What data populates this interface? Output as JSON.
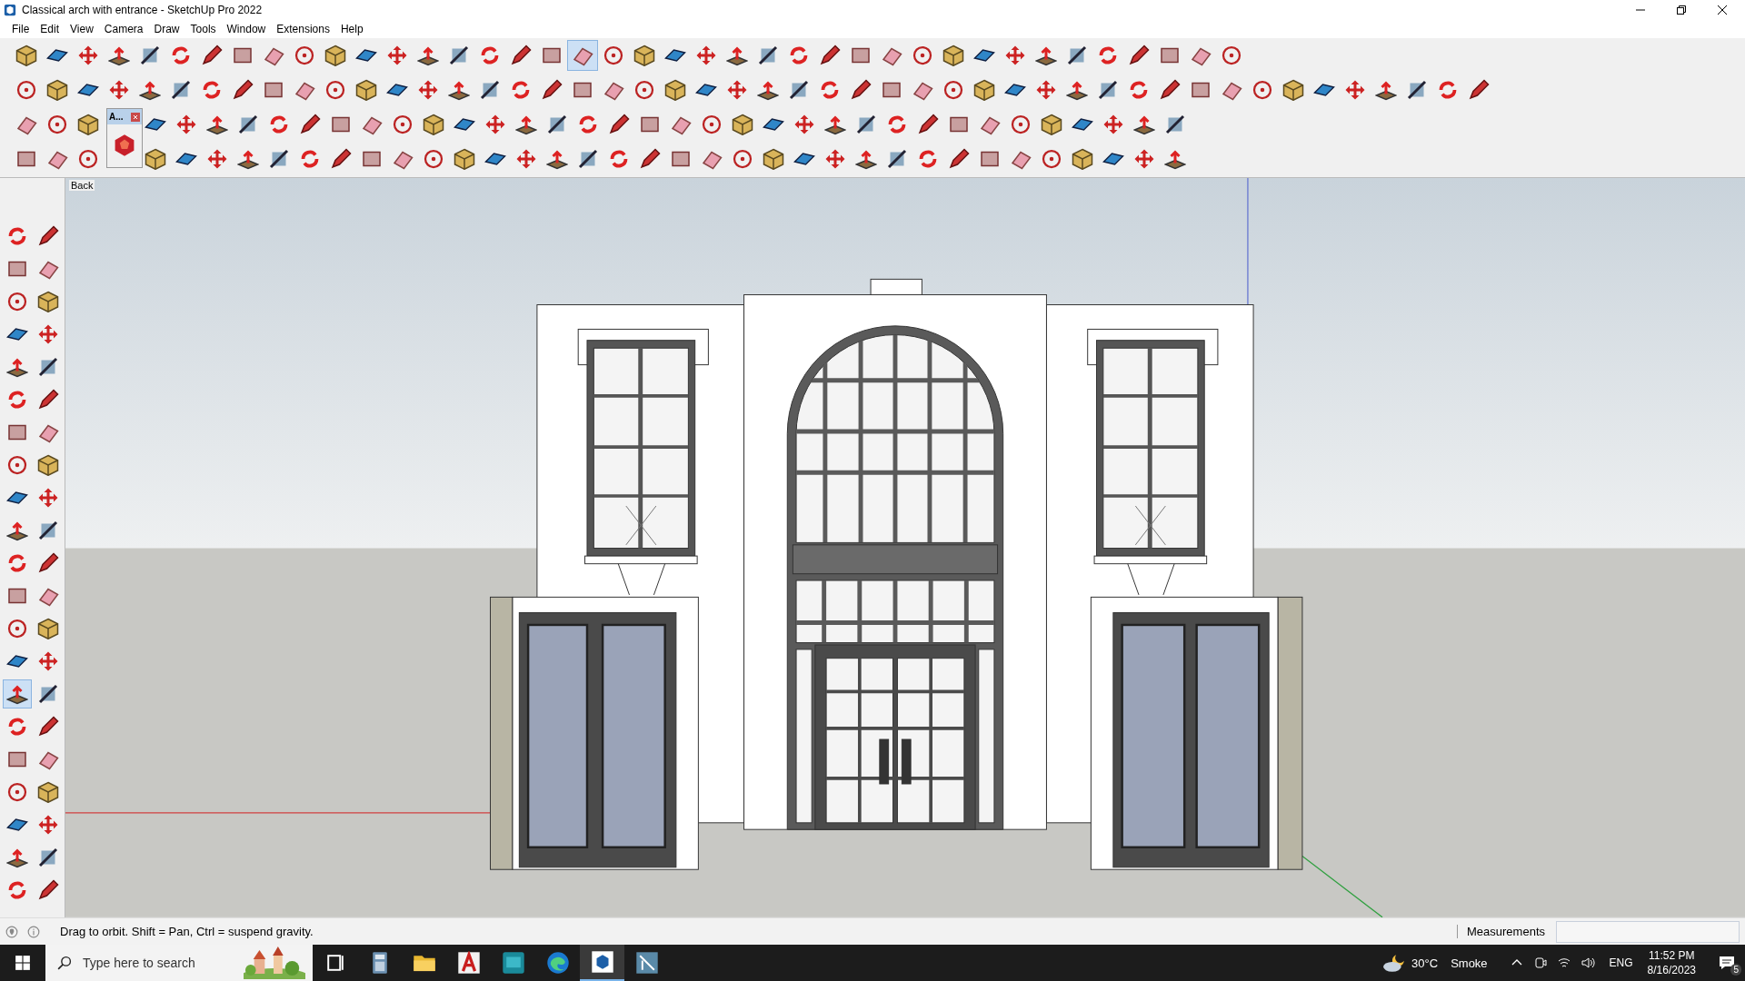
{
  "window": {
    "title": "Classical arch with entrance - SketchUp Pro 2022"
  },
  "menu": [
    "File",
    "Edit",
    "View",
    "Camera",
    "Draw",
    "Tools",
    "Window",
    "Extensions",
    "Help"
  ],
  "toolbars": [
    {
      "buttons": [
        {
          "selected": false
        },
        {
          "selected": false
        },
        {
          "selected": false
        },
        {
          "selected": false
        },
        {
          "selected": false
        },
        {
          "selected": false
        },
        {
          "selected": false
        },
        {
          "selected": false
        },
        {
          "selected": false
        },
        {
          "selected": false
        },
        {
          "selected": false
        },
        {
          "selected": false
        },
        {
          "selected": false
        },
        {
          "selected": false
        },
        {
          "selected": false
        },
        {
          "selected": false
        },
        {
          "selected": false
        },
        {
          "selected": false
        },
        {
          "selected": true
        },
        {
          "selected": false
        },
        {
          "selected": false
        },
        {
          "selected": false
        },
        {
          "selected": false
        },
        {
          "selected": false
        },
        {
          "selected": false
        },
        {
          "selected": false
        },
        {
          "selected": false
        },
        {
          "selected": false
        },
        {
          "selected": false
        },
        {
          "selected": false
        },
        {
          "selected": false
        },
        {
          "selected": false
        },
        {
          "selected": false
        },
        {
          "selected": false
        },
        {
          "selected": false
        },
        {
          "selected": false
        },
        {
          "selected": false
        },
        {
          "selected": false
        },
        {
          "selected": false
        },
        {
          "selected": false
        }
      ]
    },
    {
      "buttons": [
        {
          "selected": false
        },
        {
          "selected": false
        },
        {
          "selected": false
        },
        {
          "selected": false
        },
        {
          "selected": false
        },
        {
          "selected": false
        },
        {
          "selected": false
        },
        {
          "selected": false
        },
        {
          "selected": false
        },
        {
          "selected": false
        },
        {
          "selected": false
        },
        {
          "selected": false
        },
        {
          "selected": false
        },
        {
          "selected": false
        },
        {
          "selected": false
        },
        {
          "selected": false
        },
        {
          "selected": false
        },
        {
          "selected": false
        },
        {
          "selected": false
        },
        {
          "selected": false
        },
        {
          "selected": false
        },
        {
          "selected": false
        },
        {
          "selected": false
        },
        {
          "selected": false
        },
        {
          "selected": false
        },
        {
          "selected": false
        },
        {
          "selected": false
        },
        {
          "selected": false
        },
        {
          "selected": false
        },
        {
          "selected": false
        },
        {
          "selected": false
        },
        {
          "selected": false
        },
        {
          "selected": false
        },
        {
          "selected": false
        },
        {
          "selected": false
        },
        {
          "selected": false
        },
        {
          "selected": false
        },
        {
          "selected": false
        },
        {
          "selected": false
        },
        {
          "selected": false
        },
        {
          "selected": false
        },
        {
          "selected": false
        },
        {
          "selected": false
        },
        {
          "selected": false
        },
        {
          "selected": false
        },
        {
          "selected": false
        },
        {
          "selected": false
        },
        {
          "selected": false
        }
      ]
    },
    {
      "buttons": [
        {
          "selected": false
        },
        {
          "selected": false
        },
        {
          "selected": false
        },
        {
          "selected": false
        },
        {
          "selected": false
        },
        {
          "selected": false
        },
        {
          "selected": false
        },
        {
          "selected": false
        },
        {
          "selected": false
        },
        {
          "selected": false
        },
        {
          "selected": false
        },
        {
          "selected": false
        },
        {
          "selected": false
        },
        {
          "selected": false
        },
        {
          "selected": false
        },
        {
          "selected": false
        },
        {
          "selected": false
        },
        {
          "selected": false
        },
        {
          "selected": false
        },
        {
          "selected": false
        },
        {
          "selected": false
        },
        {
          "selected": false
        },
        {
          "selected": false
        },
        {
          "selected": false
        },
        {
          "selected": false
        },
        {
          "selected": false
        },
        {
          "selected": false
        },
        {
          "selected": false
        },
        {
          "selected": false
        },
        {
          "selected": false
        },
        {
          "selected": false
        },
        {
          "selected": false
        },
        {
          "selected": false
        },
        {
          "selected": false
        },
        {
          "selected": false
        },
        {
          "selected": false
        },
        {
          "selected": false
        }
      ]
    },
    {
      "buttons": [
        {
          "selected": false
        },
        {
          "selected": false
        },
        {
          "selected": false
        },
        {
          "selected": false
        },
        {
          "selected": false
        },
        {
          "selected": false
        },
        {
          "selected": false
        },
        {
          "selected": false
        },
        {
          "selected": false
        },
        {
          "selected": false
        },
        {
          "selected": false
        },
        {
          "selected": false
        },
        {
          "selected": false
        },
        {
          "selected": false
        },
        {
          "selected": false
        },
        {
          "selected": false
        },
        {
          "selected": false
        },
        {
          "selected": false
        },
        {
          "selected": false
        },
        {
          "selected": false
        },
        {
          "selected": false
        },
        {
          "selected": false
        },
        {
          "selected": false
        },
        {
          "selected": false
        },
        {
          "selected": false
        },
        {
          "selected": false
        },
        {
          "selected": false
        },
        {
          "selected": false
        },
        {
          "selected": false
        },
        {
          "selected": false
        },
        {
          "selected": false
        },
        {
          "selected": false
        },
        {
          "selected": false
        },
        {
          "selected": false
        },
        {
          "selected": false
        },
        {
          "selected": false
        },
        {
          "selected": false
        }
      ]
    }
  ],
  "floating_panel": {
    "title": "A..."
  },
  "tool_palette": {
    "buttons": [
      {
        "selected": false
      },
      {
        "selected": false
      },
      {
        "selected": false
      },
      {
        "selected": false
      },
      {
        "selected": false
      },
      {
        "selected": false
      },
      {
        "selected": false
      },
      {
        "selected": false
      },
      {
        "selected": false
      },
      {
        "selected": false
      },
      {
        "selected": false
      },
      {
        "selected": false
      },
      {
        "selected": false
      },
      {
        "selected": false
      },
      {
        "selected": false
      },
      {
        "selected": false
      },
      {
        "selected": false
      },
      {
        "selected": false
      },
      {
        "selected": false
      },
      {
        "selected": false
      },
      {
        "selected": false
      },
      {
        "selected": false
      },
      {
        "selected": false
      },
      {
        "selected": false
      },
      {
        "selected": false
      },
      {
        "selected": false
      },
      {
        "selected": false
      },
      {
        "selected": false
      },
      {
        "selected": true
      },
      {
        "selected": false
      },
      {
        "selected": false
      },
      {
        "selected": false
      },
      {
        "selected": false
      },
      {
        "selected": false
      },
      {
        "selected": false
      },
      {
        "selected": false
      },
      {
        "selected": false
      },
      {
        "selected": false
      },
      {
        "selected": false
      },
      {
        "selected": false
      },
      {
        "selected": false
      },
      {
        "selected": false
      }
    ]
  },
  "viewport": {
    "scene_label": "Back"
  },
  "status_bar": {
    "hint": "Drag to orbit. Shift = Pan, Ctrl = suspend gravity.",
    "measurements_label": "Measurements"
  },
  "taskbar": {
    "search_placeholder": "Type here to search",
    "apps": [
      {
        "kind": "taskview",
        "selected": false
      },
      {
        "kind": "calculator",
        "selected": false
      },
      {
        "kind": "folder",
        "selected": false
      },
      {
        "kind": "cad",
        "selected": false
      },
      {
        "kind": "max",
        "selected": false
      },
      {
        "kind": "browser",
        "selected": false
      },
      {
        "kind": "sketchup",
        "selected": true
      },
      {
        "kind": "layout",
        "selected": false
      }
    ],
    "weather": {
      "temperature": "30°C",
      "condition": "Smoke"
    },
    "language": "ENG",
    "time": "11:52 PM",
    "date": "8/16/2023",
    "notifications": "5"
  }
}
